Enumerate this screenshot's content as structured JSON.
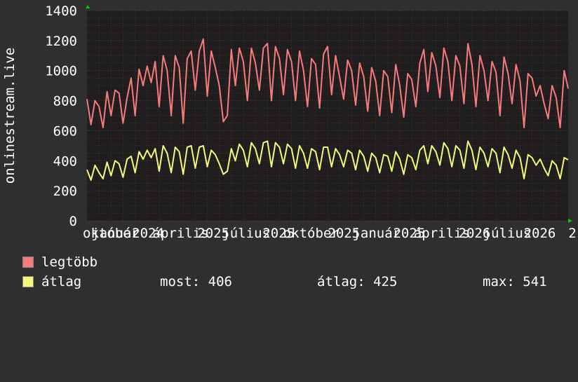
{
  "chart_data": {
    "type": "line",
    "ylabel": "onlinestream.live",
    "ylim": [
      0,
      1400
    ],
    "yticks": [
      0,
      200,
      400,
      600,
      800,
      1000,
      1200,
      1400
    ],
    "grid": true,
    "x_tick_labels": [
      "október",
      "január",
      "2024",
      "április",
      "2025",
      "július",
      "2025",
      "október",
      "2025",
      "január",
      "2025",
      "április",
      "2026",
      "július",
      "2026",
      "2"
    ],
    "series": [
      {
        "name": "legtöbb",
        "color": "#f77b7b",
        "values": [
          810,
          640,
          800,
          760,
          620,
          860,
          700,
          870,
          850,
          650,
          820,
          950,
          700,
          1010,
          900,
          1030,
          920,
          1060,
          760,
          1100,
          1000,
          700,
          1100,
          1020,
          650,
          1080,
          1130,
          870,
          1130,
          1210,
          830,
          1130,
          1020,
          900,
          660,
          700,
          1140,
          900,
          1150,
          1060,
          800,
          1150,
          1050,
          870,
          1150,
          1180,
          800,
          1160,
          1080,
          840,
          1140,
          1060,
          800,
          1130,
          1000,
          760,
          1080,
          1040,
          750,
          1110,
          1160,
          840,
          1100,
          960,
          810,
          1070,
          1000,
          770,
          1050,
          960,
          730,
          1020,
          930,
          700,
          1000,
          960,
          720,
          1040,
          900,
          690,
          980,
          940,
          760,
          1050,
          1140,
          860,
          1120,
          1030,
          820,
          1150,
          1060,
          800,
          1100,
          1030,
          780,
          1180,
          1040,
          760,
          1100,
          1000,
          800,
          1060,
          990,
          700,
          1090,
          980,
          780,
          1040,
          930,
          620,
          980,
          950,
          830,
          900,
          780,
          680,
          900,
          820,
          620,
          1000,
          880
        ]
      },
      {
        "name": "átlag",
        "color": "#f7f77b",
        "values": [
          340,
          270,
          370,
          320,
          280,
          390,
          300,
          400,
          380,
          290,
          410,
          430,
          320,
          460,
          410,
          470,
          420,
          480,
          330,
          500,
          450,
          320,
          490,
          460,
          310,
          490,
          500,
          350,
          490,
          500,
          360,
          470,
          440,
          380,
          310,
          330,
          480,
          400,
          510,
          470,
          360,
          520,
          480,
          380,
          520,
          530,
          360,
          520,
          490,
          380,
          510,
          480,
          350,
          500,
          450,
          350,
          480,
          460,
          340,
          490,
          490,
          360,
          480,
          440,
          360,
          470,
          450,
          340,
          470,
          430,
          330,
          450,
          420,
          320,
          440,
          430,
          330,
          460,
          410,
          310,
          440,
          420,
          340,
          470,
          500,
          380,
          500,
          460,
          370,
          520,
          480,
          360,
          500,
          470,
          350,
          530,
          470,
          340,
          490,
          450,
          360,
          480,
          450,
          320,
          490,
          440,
          350,
          470,
          420,
          280,
          440,
          420,
          370,
          410,
          350,
          300,
          400,
          370,
          280,
          420,
          406
        ]
      }
    ]
  },
  "legend": {
    "series1_label": "legtöbb",
    "series2_label": "átlag",
    "most_label": "most: 406",
    "atlag_label": "átlag: 425",
    "max_label": "max: 541"
  }
}
